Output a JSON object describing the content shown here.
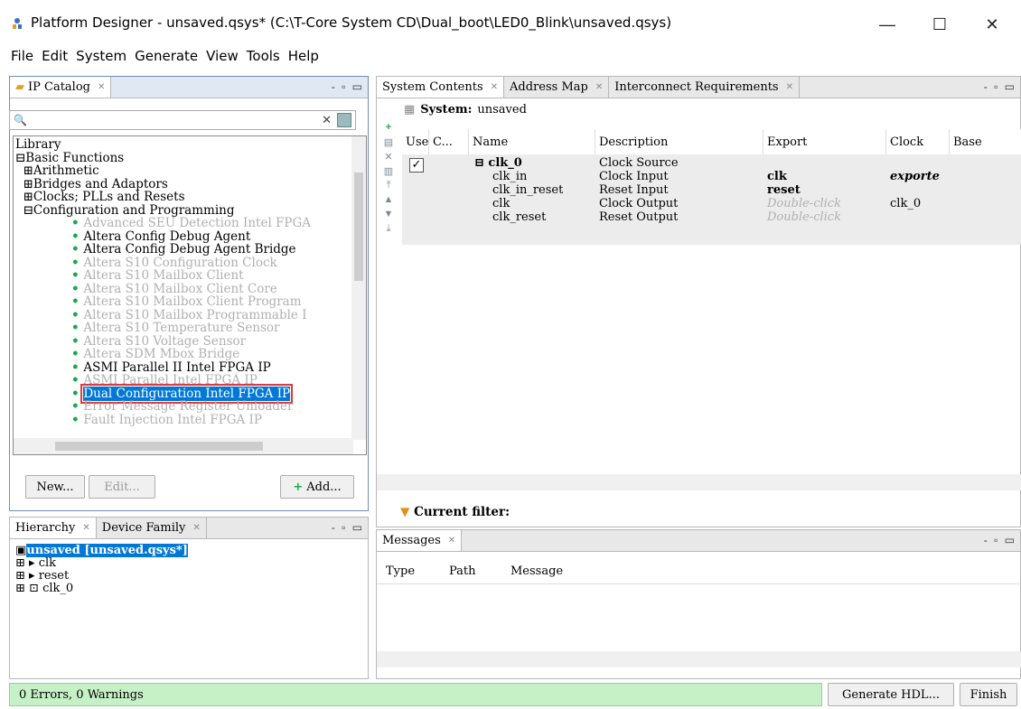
{
  "window": {
    "title": "Platform Designer - unsaved.qsys* (C:\\T-Core System CD\\Dual_boot\\LED0_Blink\\unsaved.qsys)",
    "minimize": "—",
    "maximize": "☐",
    "close": "✕"
  },
  "menu": [
    "File",
    "Edit",
    "System",
    "Generate",
    "View",
    "Tools",
    "Help"
  ],
  "ip_catalog": {
    "tab": "IP Catalog",
    "search_placeholder": "",
    "tree": [
      {
        "text": "Library",
        "dim": false
      },
      {
        "text": "⊟Basic Functions",
        "dim": false
      },
      {
        "text": "  ⊞Arithmetic",
        "dim": false
      },
      {
        "text": "  ⊞Bridges and Adaptors",
        "dim": false
      },
      {
        "text": "  ⊞Clocks; PLLs and Resets",
        "dim": false
      },
      {
        "text": "  ⊟Configuration and Programming",
        "dim": false
      },
      {
        "text": "Advanced SEU Detection Intel FPGA",
        "dim": true
      },
      {
        "text": "Altera Config Debug Agent",
        "dim": false
      },
      {
        "text": "Altera Config Debug Agent Bridge",
        "dim": false
      },
      {
        "text": "Altera S10 Configuration Clock",
        "dim": true
      },
      {
        "text": "Altera S10 Mailbox Client",
        "dim": true
      },
      {
        "text": "Altera S10 Mailbox Client Core",
        "dim": true
      },
      {
        "text": "Altera S10 Mailbox Client Program",
        "dim": true
      },
      {
        "text": "Altera S10 Mailbox Programmable I",
        "dim": true
      },
      {
        "text": "Altera S10 Temperature Sensor",
        "dim": true
      },
      {
        "text": "Altera S10 Voltage Sensor",
        "dim": true
      },
      {
        "text": "Altera SDM Mbox Bridge",
        "dim": true
      },
      {
        "text": "ASMI Parallel II Intel FPGA IP",
        "dim": false
      },
      {
        "text": "ASMI Parallel Intel FPGA IP",
        "dim": true
      },
      {
        "text": "Dual Configuration Intel FPGA IP",
        "dim": false,
        "selected": true
      },
      {
        "text": "Error Message Register Unloader",
        "dim": true
      },
      {
        "text": "Fault Injection Intel FPGA IP",
        "dim": true
      }
    ],
    "new_btn": "New...",
    "edit_btn": "Edit...",
    "add_btn": "Add..."
  },
  "hierarchy": {
    "tabs": [
      "Hierarchy",
      "Device Family"
    ],
    "root": "unsaved [unsaved.qsys*]",
    "items": [
      "clk",
      "reset",
      "clk_0"
    ]
  },
  "system": {
    "tabs": [
      "System Contents",
      "Address Map",
      "Interconnect Requirements"
    ],
    "system_label": "System:",
    "system_name": "unsaved",
    "columns": [
      "Use",
      "C...",
      "Name",
      "Description",
      "Export",
      "Clock",
      "Base"
    ],
    "rows": [
      {
        "name": "⊟ clk_0",
        "desc": "Clock Source",
        "export": "",
        "clock": ""
      },
      {
        "name": "clk_in",
        "desc": "Clock Input",
        "export": "clk",
        "clock": "exporte"
      },
      {
        "name": "clk_in_reset",
        "desc": "Reset Input",
        "export": "reset",
        "clock": ""
      },
      {
        "name": "clk",
        "desc": "Clock Output",
        "export": "Double-click",
        "clock": "clk_0"
      },
      {
        "name": "clk_reset",
        "desc": "Reset Output",
        "export": "Double-click",
        "clock": ""
      }
    ],
    "filter": "Current filter:"
  },
  "messages": {
    "tab": "Messages",
    "columns": [
      "Type",
      "Path",
      "Message"
    ]
  },
  "status": {
    "text": "0 Errors, 0 Warnings",
    "generate_btn": "Generate HDL...",
    "finish_btn": "Finish"
  }
}
